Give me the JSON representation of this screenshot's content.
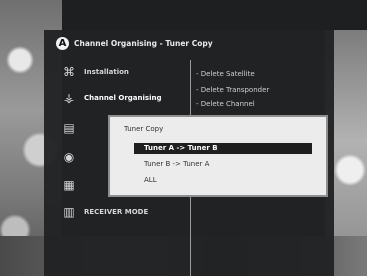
{
  "title_bar": {
    "badge": "A",
    "text": "Channel Organising - Tuner Copy"
  },
  "menu": [
    {
      "icon": "antenna-icon",
      "glyph": "⌘",
      "label": "Installation",
      "selected": false
    },
    {
      "icon": "satellite-icon",
      "glyph": "⚶",
      "label": "Channel Organising",
      "selected": true
    },
    {
      "icon": "document-icon",
      "glyph": "▤",
      "label": "",
      "selected": false
    },
    {
      "icon": "disc-icon",
      "glyph": "◉",
      "label": "",
      "selected": false
    },
    {
      "icon": "tv-icon",
      "glyph": "▦",
      "label": "",
      "selected": false
    },
    {
      "icon": "list-icon",
      "glyph": "▥",
      "label": "RECEIVER MODE",
      "selected": false
    }
  ],
  "submenu": [
    "- Delete Satellite",
    "- Delete Transponder",
    "- Delete Channel"
  ],
  "popup": {
    "title": "Tuner Copy",
    "options": [
      {
        "label": "Tuner A -> Tuner B",
        "selected": true
      },
      {
        "label": "Tuner B -> Tuner A",
        "selected": false
      },
      {
        "label": "ALL",
        "selected": false
      }
    ]
  }
}
